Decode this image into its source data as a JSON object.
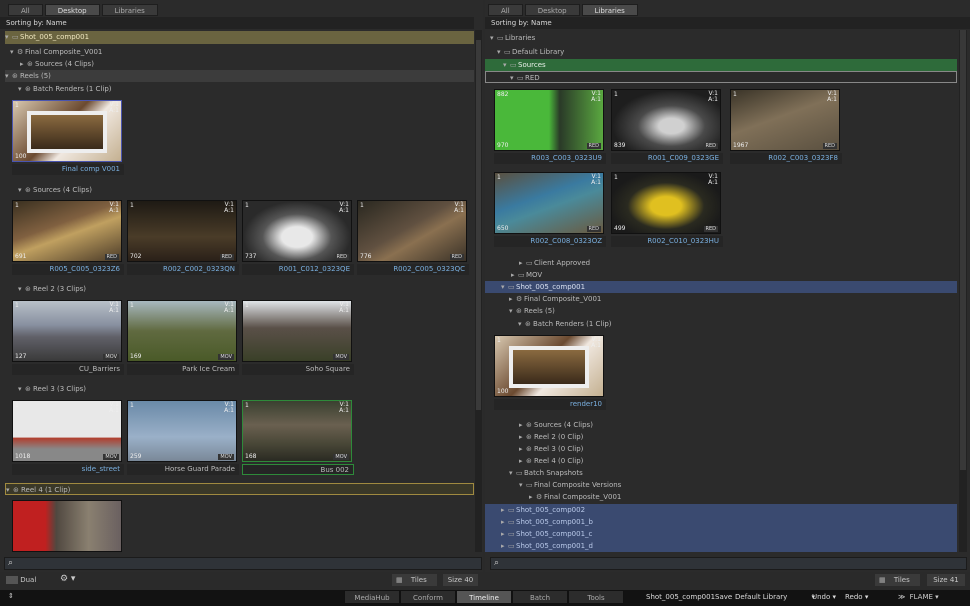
{
  "left": {
    "tabs": [
      "All",
      "Desktop",
      "Libraries"
    ],
    "sort_label": "Sorting by: Name",
    "tree": {
      "root": "Shot_005_comp001",
      "composite": "Final Composite_V001",
      "sources": "Sources (4 Clips)",
      "reels": "Reels (5)",
      "batch_renders": "Batch Renders (1 Clip)",
      "sources2": "Sources (4 Clips)",
      "reel2": "Reel 2 (3 Clips)",
      "reel3": "Reel 3 (3 Clips)",
      "reel4": "Reel 4 (1 Clip)"
    },
    "thumbs": {
      "final_comp": {
        "name": "Final comp V001",
        "tl": "1",
        "tr": "V:1\nA:1",
        "bl": "100",
        "br": ""
      },
      "s1": {
        "name": "R005_C005_0323Z6",
        "tl": "1",
        "tr": "V:1\nA:1",
        "bl": "691",
        "br": "RED"
      },
      "s2": {
        "name": "R002_C002_0323QN",
        "tl": "1",
        "tr": "V:1\nA:1",
        "bl": "702",
        "br": "RED"
      },
      "s3": {
        "name": "R001_C012_0323QE",
        "tl": "1",
        "tr": "V:1\nA:1",
        "bl": "737",
        "br": "RED"
      },
      "s4": {
        "name": "R002_C005_0323QC",
        "tl": "1",
        "tr": "V:1\nA:1",
        "bl": "776",
        "br": "RED"
      },
      "r2a": {
        "name": "CU_Barriers",
        "tl": "1",
        "tr": "V:1\nA:1",
        "bl": "127",
        "br": "MOV"
      },
      "r2b": {
        "name": "Park Ice Cream",
        "tl": "1",
        "tr": "V:1\nA:1",
        "bl": "169",
        "br": "MOV"
      },
      "r2c": {
        "name": "Soho Square",
        "tl": "1",
        "tr": "V:1\nA:1",
        "bl": "",
        "br": "MOV"
      },
      "r3a": {
        "name": "side_street",
        "tl": "1",
        "tr": "V:1\nA:1",
        "bl": "1018",
        "br": "MOV"
      },
      "r3b": {
        "name": "Horse Guard Parade",
        "tl": "1",
        "tr": "V:1\nA:1",
        "bl": "259",
        "br": "MOV"
      },
      "r3c": {
        "name": "Bus 002",
        "tl": "1",
        "tr": "V:1\nA:1",
        "bl": "168",
        "br": "MOV"
      }
    },
    "dual_label": "Dual",
    "tiles_label": "Tiles",
    "size_label": "Size 40"
  },
  "right": {
    "tabs": [
      "All",
      "Desktop",
      "Libraries"
    ],
    "sort_label": "Sorting by: Name",
    "tree": {
      "libraries": "Libraries",
      "default_library": "Default Library",
      "sources": "Sources",
      "red": "RED",
      "client_approved": "Client Approved",
      "mov": "MOV",
      "shot": "Shot_005_comp001",
      "final_comp": "Final Composite_V001",
      "reels": "Reels (5)",
      "batch_renders": "Batch Renders (1 Clip)",
      "src4": "Sources (4 Clips)",
      "reel2": "Reel 2 (0 Clip)",
      "reel3": "Reel 3 (0 Clip)",
      "reel4": "Reel 4 (0 Clip)",
      "batch_snapshots": "Batch Snapshots",
      "fcv": "Final Composite Versions",
      "fcv1": "Final Composite_V001",
      "shot2": "Shot_005_comp002",
      "shotb": "Shot_005_comp001_b",
      "shotc": "Shot_005_comp001_c",
      "shotd": "Shot_005_comp001_d"
    },
    "thumbs": {
      "a": {
        "name": "R003_C003_0323U9",
        "tl": "882",
        "tr": "V:1\nA:1",
        "bl": "970",
        "br": "RED"
      },
      "b": {
        "name": "R001_C009_0323GE",
        "tl": "1",
        "tr": "V:1\nA:1",
        "bl": "839",
        "br": "RED"
      },
      "c": {
        "name": "R002_C003_0323F8",
        "tl": "1",
        "tr": "V:1\nA:1",
        "bl": "1967",
        "br": "RED"
      },
      "d": {
        "name": "R002_C008_0323OZ",
        "tl": "1",
        "tr": "V:1\nA:1",
        "bl": "650",
        "br": "RED"
      },
      "e": {
        "name": "R002_C010_0323HU",
        "tl": "1",
        "tr": "V:1\nA:1",
        "bl": "499",
        "br": "RED"
      },
      "render": {
        "name": "render10",
        "tl": "1",
        "tr": "V:1\nA:1",
        "bl": "100",
        "br": ""
      }
    },
    "tiles_label": "Tiles",
    "size_label": "Size 41"
  },
  "bottom": {
    "tabs": [
      "MediaHub",
      "Conform",
      "Timeline",
      "Batch",
      "Tools"
    ],
    "active_tab": "Timeline",
    "shot_name": "Shot_005_comp001",
    "save": "Save",
    "library": "Default Library",
    "undo": "Undo",
    "redo": "Redo",
    "app": "FLAME"
  },
  "colors": {
    "selection": "#3a4a70",
    "gold": "#6a6440",
    "green": "#2e6b3a"
  }
}
